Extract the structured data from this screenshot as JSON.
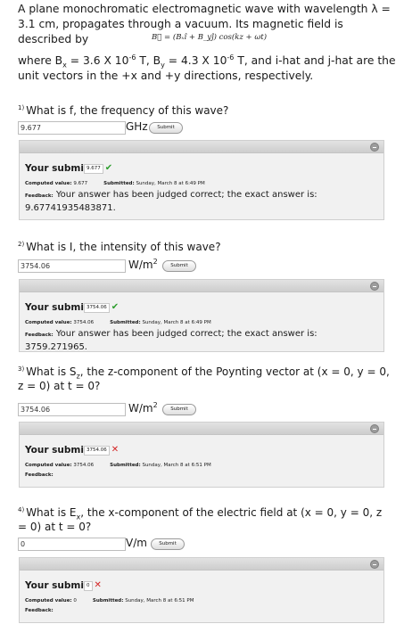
{
  "intro": {
    "line1_pre": "A plane monochromatic electromagnetic wave with wavelength λ = 3.1 cm, propagates through a vacuum. Its magnetic field is described by",
    "equation": "B⃗ = (Bₓî + B_yĵ) cos(kz + ωt)",
    "where": {
      "p1": "where B",
      "bx_sub": "x",
      "bx_val": " = 3.6 X 10",
      "bx_exp": "-6",
      "p2": " T, B",
      "by_sub": "y",
      "by_val": " = 4.3 X 10",
      "by_exp": "-6",
      "p3": " T, and i-hat and j-hat are the unit vectors in the +x and +y directions, respectively."
    }
  },
  "submit_label": "Submit",
  "your_submission_label": "Your submissi",
  "computed_label": "Computed value:",
  "submitted_label": "Submitted:",
  "feedback_label": "Feedback:",
  "questions": [
    {
      "num": "1)",
      "text": "What is f, the frequency of this wave?",
      "input_value": "9.677",
      "unit": "GHz",
      "unit_exp": "",
      "sub_value": "9.677",
      "computed": "9.677",
      "submitted": "Sunday, March 8 at 6:49 PM",
      "feedback": "Your answer has been judged correct; the exact answer is: 9.67741935483871."
    },
    {
      "num": "2)",
      "text": "What is I, the intensity of this wave?",
      "input_value": "3754.06",
      "unit": "W/m",
      "unit_exp": "2",
      "sub_value": "3754.06",
      "computed": "3754.06",
      "submitted": "Sunday, March 8 at 6:49 PM",
      "feedback": "Your answer has been judged correct; the exact answer is: 3759.271965."
    },
    {
      "num": "3)",
      "text_pre": "What is S",
      "text_sub": "z",
      "text_post": ", the z-component of the Poynting vector at (x = 0, y = 0, z = 0) at t = 0?",
      "input_value": "3754.06",
      "unit": "W/m",
      "unit_exp": "2",
      "sub_value": "3754.06",
      "computed": "3754.06",
      "submitted": "Sunday, March 8 at 6:51 PM",
      "feedback": ""
    },
    {
      "num": "4)",
      "text_pre": "What is E",
      "text_sub": "x",
      "text_post": ", the x-component of the electric field at (x = 0, y = 0, z = 0) at t = 0?",
      "input_value": "0",
      "unit": "V/m",
      "unit_exp": "",
      "sub_value": "0",
      "computed": "0",
      "submitted": "Sunday, March 8 at 6:51 PM",
      "feedback": ""
    }
  ]
}
